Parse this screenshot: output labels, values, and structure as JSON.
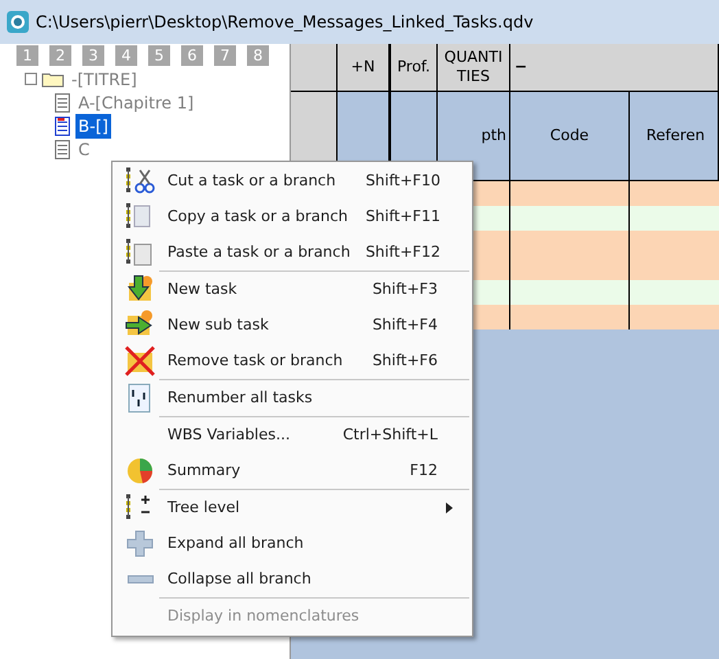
{
  "window": {
    "title": "C:\\Users\\pierr\\Desktop\\Remove_Messages_Linked_Tasks.qdv"
  },
  "level_buttons": [
    "1",
    "2",
    "3",
    "4",
    "5",
    "6",
    "7",
    "8"
  ],
  "tree": [
    {
      "label": "-[TITRE]",
      "selected": false,
      "children": [
        {
          "label": "A-[Chapitre 1]",
          "selected": false
        },
        {
          "label": "B-[]",
          "selected": true
        },
        {
          "label": "C",
          "selected": false
        }
      ]
    }
  ],
  "grid": {
    "header_top": [
      "+N",
      "Prof.",
      "QUANTITIES",
      "−"
    ],
    "header_bottom": [
      "pth",
      "Code",
      "Referen"
    ],
    "rows": [
      {
        "color": "#fcd5b4"
      },
      {
        "color": "#ebfbe9"
      },
      {
        "color": "#fcd5b4"
      },
      {
        "color": "#fcd5b4"
      },
      {
        "color": "#ebfbe9"
      },
      {
        "color": "#fcd5b4"
      }
    ]
  },
  "context_menu": [
    [
      {
        "label": "Cut a task or a branch",
        "shortcut": "Shift+F10",
        "disabled": false,
        "submenu": false
      },
      {
        "label": "Copy a task or a branch",
        "shortcut": "Shift+F11",
        "disabled": false,
        "submenu": false
      },
      {
        "label": "Paste a task or a branch",
        "shortcut": "Shift+F12",
        "disabled": false,
        "submenu": false
      }
    ],
    [
      {
        "label": "New task",
        "shortcut": "Shift+F3",
        "disabled": false,
        "submenu": false
      },
      {
        "label": "New sub task",
        "shortcut": "Shift+F4",
        "disabled": false,
        "submenu": false
      },
      {
        "label": "Remove task or branch",
        "shortcut": "Shift+F6",
        "disabled": false,
        "submenu": false
      }
    ],
    [
      {
        "label": "Renumber all tasks",
        "disabled": false,
        "submenu": false
      }
    ],
    [
      {
        "label": "WBS Variables...",
        "shortcut": "Ctrl+Shift+L",
        "disabled": false,
        "submenu": false
      },
      {
        "label": "Summary",
        "shortcut": "F12",
        "disabled": false,
        "submenu": false
      }
    ],
    [
      {
        "label": "Tree level",
        "disabled": false,
        "submenu": true
      },
      {
        "label": "Expand all branch",
        "disabled": false,
        "submenu": false
      },
      {
        "label": "Collapse all branch",
        "disabled": false,
        "submenu": false
      }
    ],
    [
      {
        "label": "Display in nomenclatures",
        "disabled": true,
        "submenu": false
      }
    ]
  ]
}
